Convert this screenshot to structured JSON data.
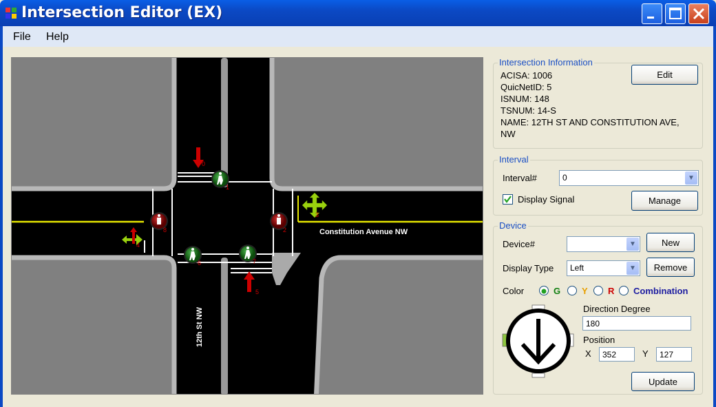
{
  "window": {
    "title": "Intersection Editor (EX)"
  },
  "menu": {
    "file": "File",
    "help": "Help"
  },
  "map": {
    "street_ew": "Constitution Avenue NW",
    "street_ns": "12th St NW",
    "signal_numbers": [
      "0",
      "1",
      "2",
      "3",
      "4",
      "5",
      "6",
      "7",
      "8"
    ]
  },
  "info": {
    "group_label": "Intersection Information",
    "acisa": "ACISA: 1006",
    "quicnet": "QuicNetID: 5",
    "isnum": "ISNUM: 148",
    "tsnum": "TSNUM: 14-S",
    "name_line1": "NAME: 12TH ST AND CONSTITUTION AVE,",
    "name_line2": "NW",
    "edit_label": "Edit"
  },
  "interval": {
    "group_label": "Interval",
    "interval_label": "Interval#",
    "interval_value": "0",
    "display_signal_label": "Display Signal",
    "display_signal_checked": true,
    "manage_label": "Manage"
  },
  "device": {
    "group_label": "Device",
    "device_label": "Device#",
    "device_value": "",
    "new_label": "New",
    "display_type_label": "Display Type",
    "display_type_value": "Left",
    "remove_label": "Remove",
    "color_label": "Color",
    "color_g": "G",
    "color_y": "Y",
    "color_r": "R",
    "color_combination": "Combination",
    "selected_color": "G",
    "direction_label": "Direction Degree",
    "direction_value": "180",
    "position_label": "Position",
    "x_label": "X",
    "x_value": "352",
    "y_label": "Y",
    "y_value": "127",
    "update_label": "Update"
  },
  "colors": {
    "green": "#0f7e0f",
    "yellow": "#e8a000",
    "red": "#cc0000",
    "combination": "#1a1aa0",
    "titlebar": "#0b49c4"
  }
}
